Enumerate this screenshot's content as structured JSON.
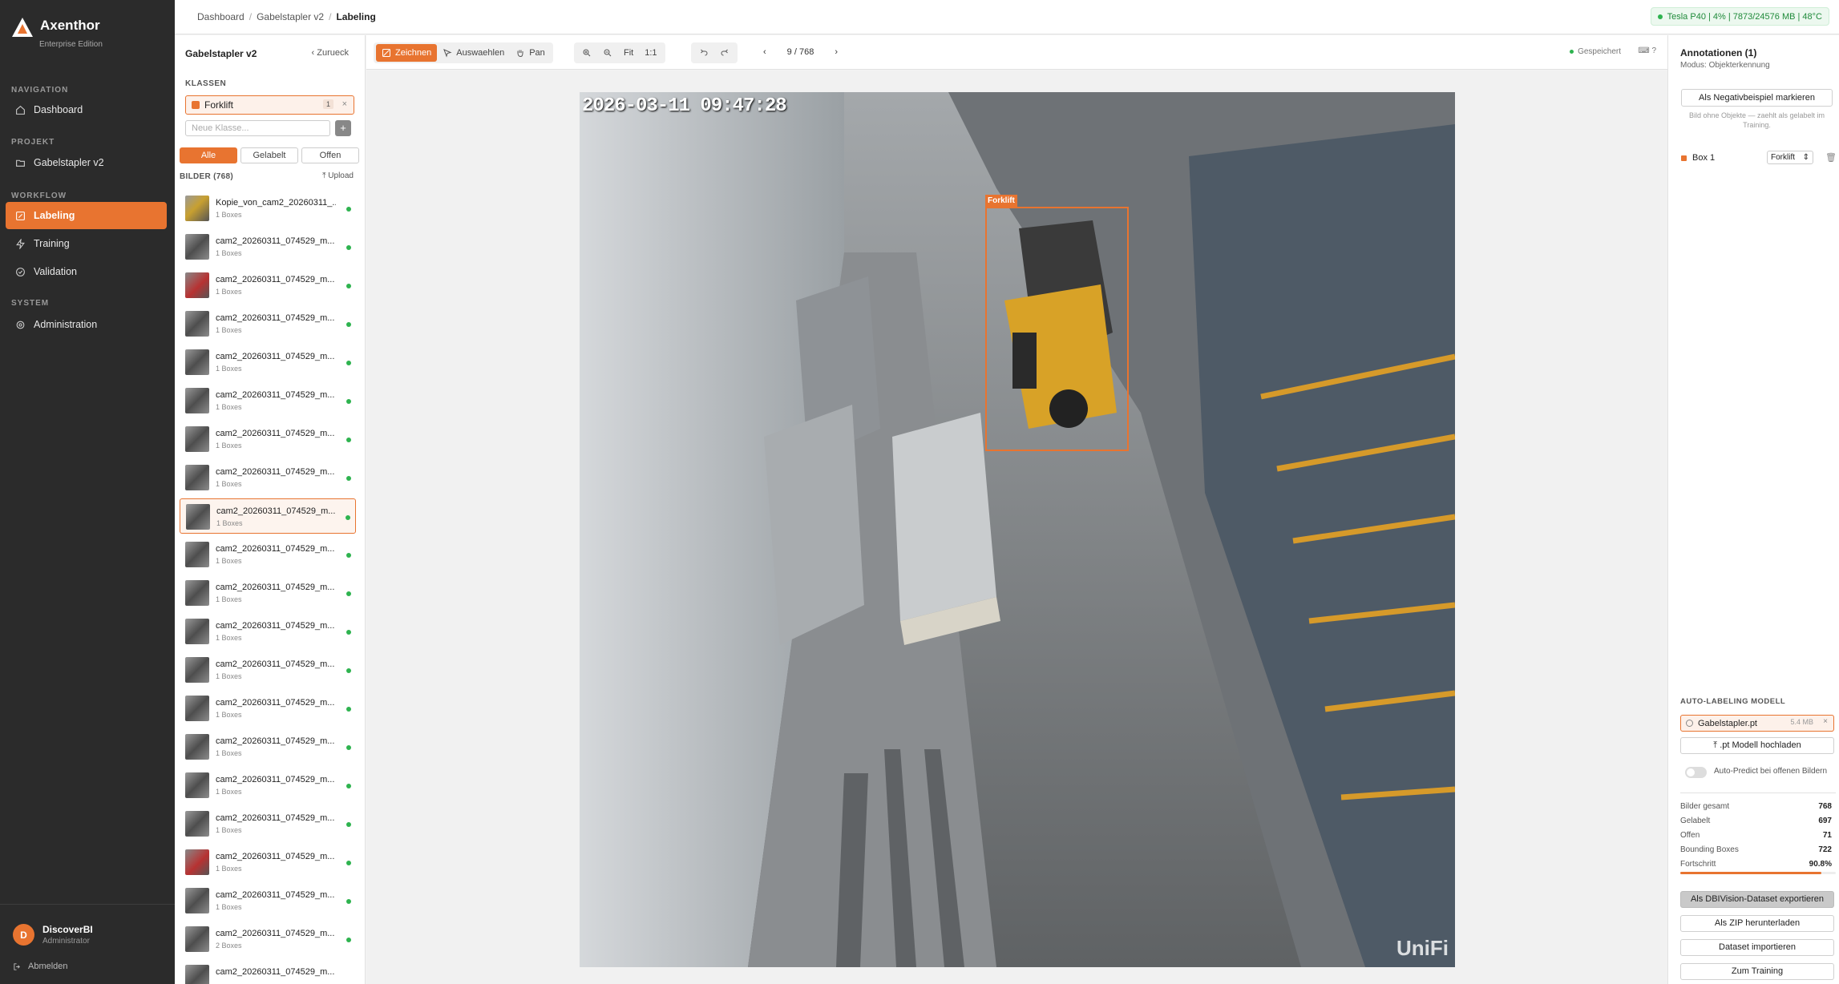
{
  "brand": {
    "title": "Axenthor",
    "subtitle": "Enterprise Edition"
  },
  "nav": {
    "navigation_label": "NAVIGATION",
    "dashboard": "Dashboard",
    "project_label": "PROJEKT",
    "project": "Gabelstapler v2",
    "workflow_label": "WORKFLOW",
    "labeling": "Labeling",
    "training": "Training",
    "validation": "Validation",
    "system_label": "SYSTEM",
    "administration": "Administration"
  },
  "user": {
    "initial": "D",
    "name": "DiscoverBI",
    "role": "Administrator",
    "logout": "Abmelden"
  },
  "breadcrumb": {
    "a": "Dashboard",
    "b": "Gabelstapler v2",
    "c": "Labeling",
    "sep": "/"
  },
  "gpu_status": "Tesla P40 | 4% | 7873/24576 MB | 48°C",
  "panel": {
    "title": "Gabelstapler v2",
    "back": "Zurueck",
    "classes_label": "KLASSEN",
    "class_name": "Forklift",
    "class_count": "1",
    "class_remove": "×",
    "new_class_placeholder": "Neue Klasse...",
    "add_class": "+",
    "filters": {
      "all": "Alle",
      "labeled": "Gelabelt",
      "open": "Offen"
    },
    "images_label": "BILDER (768)",
    "upload": "Upload"
  },
  "images": [
    {
      "name": "Kopie_von_cam2_20260311_...",
      "boxes": "1 Boxes"
    },
    {
      "name": "cam2_20260311_074529_m...",
      "boxes": "1 Boxes"
    },
    {
      "name": "cam2_20260311_074529_m...",
      "boxes": "1 Boxes"
    },
    {
      "name": "cam2_20260311_074529_m...",
      "boxes": "1 Boxes"
    },
    {
      "name": "cam2_20260311_074529_m...",
      "boxes": "1 Boxes"
    },
    {
      "name": "cam2_20260311_074529_m...",
      "boxes": "1 Boxes"
    },
    {
      "name": "cam2_20260311_074529_m...",
      "boxes": "1 Boxes"
    },
    {
      "name": "cam2_20260311_074529_m...",
      "boxes": "1 Boxes"
    },
    {
      "name": "cam2_20260311_074529_m...",
      "boxes": "1 Boxes"
    },
    {
      "name": "cam2_20260311_074529_m...",
      "boxes": "1 Boxes"
    },
    {
      "name": "cam2_20260311_074529_m...",
      "boxes": "1 Boxes"
    },
    {
      "name": "cam2_20260311_074529_m...",
      "boxes": "1 Boxes"
    },
    {
      "name": "cam2_20260311_074529_m...",
      "boxes": "1 Boxes"
    },
    {
      "name": "cam2_20260311_074529_m...",
      "boxes": "1 Boxes"
    },
    {
      "name": "cam2_20260311_074529_m...",
      "boxes": "1 Boxes"
    },
    {
      "name": "cam2_20260311_074529_m...",
      "boxes": "1 Boxes"
    },
    {
      "name": "cam2_20260311_074529_m...",
      "boxes": "1 Boxes"
    },
    {
      "name": "cam2_20260311_074529_m...",
      "boxes": "1 Boxes"
    },
    {
      "name": "cam2_20260311_074529_m...",
      "boxes": "1 Boxes"
    },
    {
      "name": "cam2_20260311_074529_m...",
      "boxes": "2 Boxes"
    },
    {
      "name": "cam2_20260311_074529_m...",
      "boxes": ""
    }
  ],
  "toolbar": {
    "draw": "Zeichnen",
    "select": "Auswaehlen",
    "pan": "Pan",
    "fit": "Fit",
    "one_to_one": "1:1",
    "page": "9 / 768",
    "saved": "Gespeichert",
    "help": "?"
  },
  "image": {
    "timestamp": "2026-03-11 09:47:28",
    "watermark": "UniFi",
    "box_label": "Forklift"
  },
  "annotations": {
    "title": "Annotationen (1)",
    "mode": "Modus: Objekterkennung",
    "negative_button": "Als Negativbeispiel markieren",
    "negative_hint": "Bild ohne Objekte — zaehlt als gelabelt im Training.",
    "box_name": "Box 1",
    "box_class": "Forklift"
  },
  "auto_label": {
    "label": "AUTO-LABELING MODELL",
    "model_name": "Gabelstapler.pt",
    "model_size": "5.4 MB",
    "upload_button": ".pt Modell hochladen",
    "toggle_label": "Auto-Predict bei offenen Bildern"
  },
  "stats": {
    "total_label": "Bilder gesamt",
    "total": "768",
    "labeled_label": "Gelabelt",
    "labeled": "697",
    "open_label": "Offen",
    "open": "71",
    "boxes_label": "Bounding Boxes",
    "boxes": "722",
    "progress_label": "Fortschritt",
    "progress": "90.8%",
    "progress_value": 0.908
  },
  "actions": {
    "export": "Als DBIVision-Dataset exportieren",
    "zip": "Als ZIP herunterladen",
    "import": "Dataset importieren",
    "training": "Zum Training"
  }
}
